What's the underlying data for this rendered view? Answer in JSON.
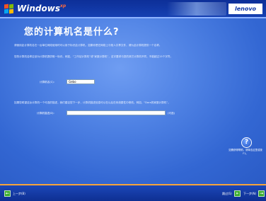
{
  "header": {
    "logo_text": "Windows",
    "logo_xp": "xp",
    "brand": "lenovo"
  },
  "main": {
    "title": "您的计算机名是什么?",
    "paragraph1": "请使用此计算机名在一台单位网络使用时可以用于标识此计算机。如果你是在网络上与他人共享文件，请为此计算机提供一个名称。",
    "paragraph2": "您的计算机名称应该为计算机提供唯一标识。例如，“工作站计算机”或“家庭计算机”，名字要求与您的其它计算机不同，不能超过15个字符。",
    "name_label": "计算机名(C):",
    "name_value": "Gebo",
    "paragraph3": "如果您希望这台计算机一个可选的描述，我们建议您下一步，计算机描述信息可以在以后在系统属性中修改。例如，“Dora的家庭计算机”。",
    "desc_label": "计算机描述(D):",
    "desc_value": "",
    "optional_label": "(可选)"
  },
  "help": {
    "text": "如需获得帮助，请单击这里或按 F1。"
  },
  "footer": {
    "back_label": "上一步(B)",
    "skip_label": "跳过(S)",
    "next_label": "下一步(N)"
  }
}
